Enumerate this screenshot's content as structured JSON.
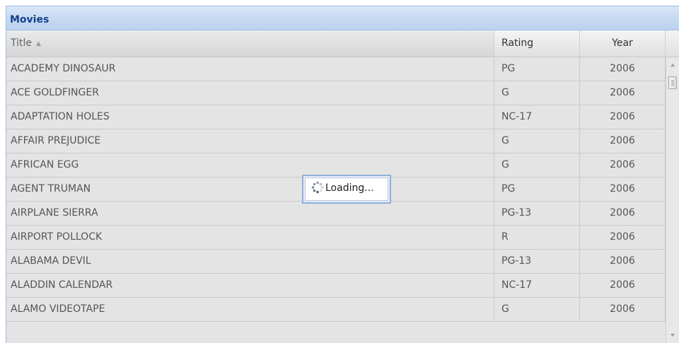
{
  "panel": {
    "title": "Movies"
  },
  "columns": {
    "title": "Title",
    "rating": "Rating",
    "year": "Year"
  },
  "rows": [
    {
      "title": "ACADEMY DINOSAUR",
      "rating": "PG",
      "year": "2006"
    },
    {
      "title": "ACE GOLDFINGER",
      "rating": "G",
      "year": "2006"
    },
    {
      "title": "ADAPTATION HOLES",
      "rating": "NC-17",
      "year": "2006"
    },
    {
      "title": "AFFAIR PREJUDICE",
      "rating": "G",
      "year": "2006"
    },
    {
      "title": "AFRICAN EGG",
      "rating": "G",
      "year": "2006"
    },
    {
      "title": "AGENT TRUMAN",
      "rating": "PG",
      "year": "2006"
    },
    {
      "title": "AIRPLANE SIERRA",
      "rating": "PG-13",
      "year": "2006"
    },
    {
      "title": "AIRPORT POLLOCK",
      "rating": "R",
      "year": "2006"
    },
    {
      "title": "ALABAMA DEVIL",
      "rating": "PG-13",
      "year": "2006"
    },
    {
      "title": "ALADDIN CALENDAR",
      "rating": "NC-17",
      "year": "2006"
    },
    {
      "title": "ALAMO VIDEOTAPE",
      "rating": "G",
      "year": "2006"
    }
  ],
  "loading": {
    "text": "Loading..."
  },
  "icons": {
    "sort": "sort-ascending-icon",
    "spinner": "loading-spinner-icon"
  }
}
